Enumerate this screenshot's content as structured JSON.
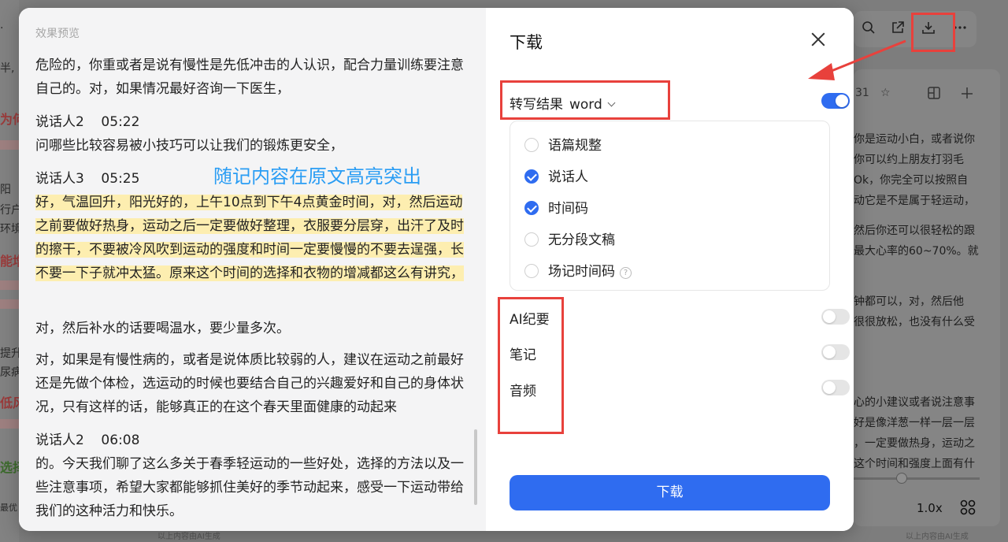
{
  "background": {
    "left_fragments": [
      "·",
      "半,",
      "为何",
      "阳",
      "行户",
      "环境",
      "能增",
      "提升",
      "尿病",
      "低风",
      "选择",
      "最优"
    ],
    "right_lines": [
      "你是运动小白，或者说你",
      "你可以约上朋友打羽毛",
      "Ok，你完全可以按照自",
      "动它是不是属于轻运动，",
      "然后你还可以很轻松的跟",
      "最大心率的60~70%。就",
      "钟都可以，对，然后他",
      "很很放松，也没有什么受",
      "心的小建议或者说注意事",
      "好是像洋葱一样一层一层",
      "，一定要做热身，运动之",
      "这个时间和强度上面有什"
    ],
    "panel_mini": "31",
    "speed": "1.0x",
    "footer_note": "以上内容由AI生成"
  },
  "preview": {
    "title": "效果预览",
    "annotation": "随记内容在原文高亮突出",
    "blocks": [
      {
        "type": "text",
        "text": "危险的，你重或者是说有慢性是先低冲击的人认识，配合力量训练要注意自己的。对，如果情况最好咨询一下医生，"
      },
      {
        "type": "speaker",
        "text": "说话人2    05:22"
      },
      {
        "type": "text",
        "text": "问哪些比较容易被小技巧可以让我们的锻炼更安全，"
      },
      {
        "type": "speaker",
        "text": "说话人3    05:25"
      },
      {
        "type": "highlight",
        "text": "好，气温回升，阳光好的，上午10点到下午4点黄金时间，对，然后运动之前要做好热身，运动之后一定要做好整理，衣服要分层穿，出汗了及时的擦干，不要被冷风吹到运动的强度和时间一定要慢慢的不要去逞强，长不要一下子就冲太猛。原来这个时间的选择和衣物的增减都这么有讲究，"
      },
      {
        "type": "text",
        "text": "对，然后补水的话要喝温水，要少量多次。"
      },
      {
        "type": "text",
        "text": "对，如果是有慢性病的，或者是说体质比较弱的人，建议在运动之前最好还是先做个体检，选运动的时候也要结合自己的兴趣爱好和自己的身体状况，只有这样的话，能够真正的在这个春天里面健康的动起来"
      },
      {
        "type": "speaker",
        "text": "说话人2    06:08"
      },
      {
        "type": "text",
        "text": "的。今天我们聊了这么多关于春季轻运动的一些好处，选择的方法以及一些注意事项，希望大家都能够抓住美好的季节动起来，感受一下运动带给我们的这种活力和快乐。"
      }
    ]
  },
  "download": {
    "title": "下载",
    "format_label": "转写结果",
    "format_value": "word",
    "format_enabled": true,
    "options": [
      {
        "label": "语篇规整",
        "checked": false
      },
      {
        "label": "说话人",
        "checked": true
      },
      {
        "label": "时间码",
        "checked": true
      },
      {
        "label": "无分段文稿",
        "checked": false
      },
      {
        "label": "场记时间码",
        "checked": false
      }
    ],
    "extras": [
      {
        "label": "AI纪要",
        "enabled": false
      },
      {
        "label": "笔记",
        "enabled": false
      },
      {
        "label": "音频",
        "enabled": false
      }
    ],
    "button_label": "下载"
  },
  "colors": {
    "accent": "#2f6cf0",
    "highlight": "#fdeeb0",
    "annotation_red": "#e8413c",
    "annotation_blue": "#2a9df4"
  }
}
